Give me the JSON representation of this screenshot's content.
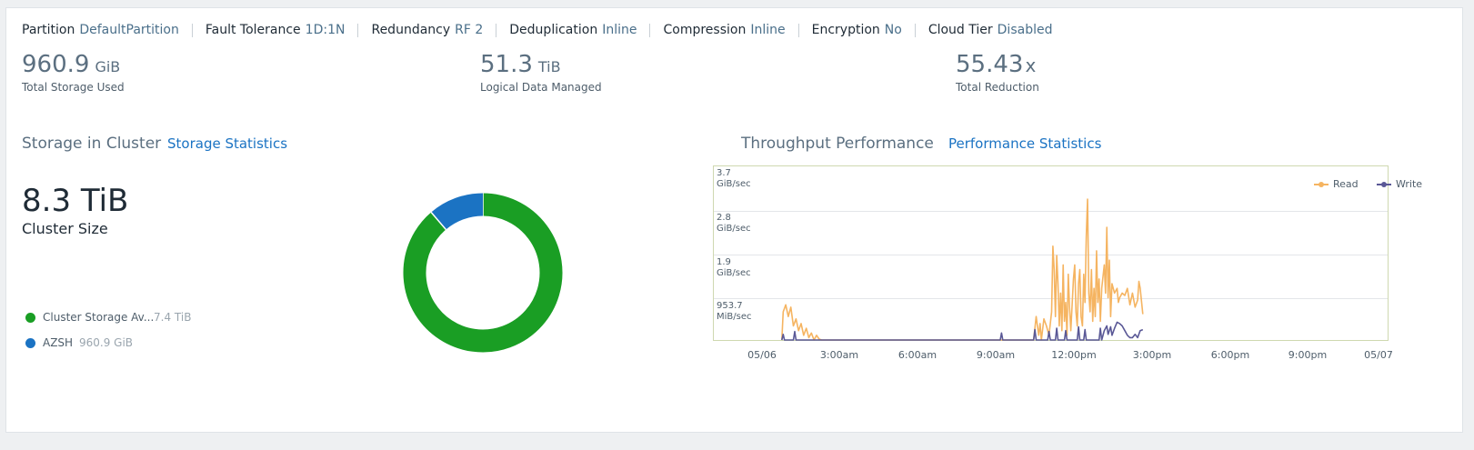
{
  "properties": [
    {
      "key": "Partition",
      "value": "DefaultPartition"
    },
    {
      "key": "Fault Tolerance",
      "value": "1D:1N"
    },
    {
      "key": "Redundancy",
      "value": "RF 2"
    },
    {
      "key": "Deduplication",
      "value": "Inline"
    },
    {
      "key": "Compression",
      "value": "Inline"
    },
    {
      "key": "Encryption",
      "value": "No"
    },
    {
      "key": "Cloud Tier",
      "value": "Disabled"
    }
  ],
  "metrics": {
    "storage_used": {
      "value": "960.9",
      "unit": "GiB",
      "label": "Total Storage Used"
    },
    "logical_data": {
      "value": "51.3",
      "unit": "TiB",
      "label": "Logical Data Managed"
    },
    "reduction": {
      "value": "55.43",
      "unit": "x",
      "label": "Total Reduction"
    }
  },
  "storage_section": {
    "title": "Storage in Cluster",
    "link": "Storage Statistics",
    "cluster_size": "8.3 TiB",
    "cluster_size_label": "Cluster Size",
    "legend": [
      {
        "name": "Cluster Storage Av...",
        "value": "7.4 TiB",
        "color": "#1a9e24"
      },
      {
        "name": "AZSH",
        "value": "960.9 GiB",
        "color": "#1b73c3"
      }
    ]
  },
  "donut": {
    "slices": [
      {
        "label": "Cluster Storage Available",
        "amount_gib": 7577.6,
        "color": "#1a9e24"
      },
      {
        "label": "AZSH",
        "amount_gib": 960.9,
        "color": "#1b73c3"
      }
    ]
  },
  "perf_section": {
    "title": "Throughput Performance",
    "link": "Performance Statistics"
  },
  "chart_data": {
    "type": "line",
    "y_ticks": [
      {
        "value": "3.7",
        "unit": "GiB/sec"
      },
      {
        "value": "2.8",
        "unit": "GiB/sec"
      },
      {
        "value": "1.9",
        "unit": "GiB/sec"
      },
      {
        "value": "953.7",
        "unit": "MiB/sec"
      }
    ],
    "x_ticks": [
      "05/06",
      "3:00am",
      "6:00am",
      "9:00am",
      "12:00pm",
      "3:00pm",
      "6:00pm",
      "9:00pm",
      "05/07"
    ],
    "ylim": [
      0,
      3.7
    ],
    "grid": true,
    "legend_position": "top-right",
    "series": [
      {
        "name": "Read",
        "color": "#f5b461",
        "points": [
          [
            0.95,
            0
          ],
          [
            1.0,
            0.6
          ],
          [
            1.1,
            0.75
          ],
          [
            1.2,
            0.5
          ],
          [
            1.3,
            0.7
          ],
          [
            1.4,
            0.3
          ],
          [
            1.5,
            0.45
          ],
          [
            1.6,
            0.2
          ],
          [
            1.7,
            0.35
          ],
          [
            1.8,
            0.1
          ],
          [
            1.9,
            0.25
          ],
          [
            2.0,
            0.05
          ],
          [
            2.1,
            0.15
          ],
          [
            2.2,
            0
          ],
          [
            2.3,
            0.1
          ],
          [
            2.4,
            0.02
          ],
          [
            2.5,
            0
          ],
          [
            10.75,
            0
          ],
          [
            10.85,
            0.5
          ],
          [
            10.95,
            0.1
          ],
          [
            11.0,
            0.35
          ],
          [
            11.05,
            0
          ],
          [
            11.15,
            0.45
          ],
          [
            11.25,
            0.3
          ],
          [
            11.35,
            0.1
          ],
          [
            11.45,
            0.6
          ],
          [
            11.5,
            2.0
          ],
          [
            11.55,
            1.5
          ],
          [
            11.6,
            0.5
          ],
          [
            11.65,
            1.8
          ],
          [
            11.7,
            1.2
          ],
          [
            11.75,
            0.3
          ],
          [
            11.8,
            1.0
          ],
          [
            11.85,
            0.2
          ],
          [
            11.9,
            1.6
          ],
          [
            11.95,
            0.4
          ],
          [
            12.0,
            0.8
          ],
          [
            12.05,
            0.1
          ],
          [
            12.1,
            1.4
          ],
          [
            12.15,
            0.7
          ],
          [
            12.2,
            0.2
          ],
          [
            12.3,
            1.3
          ],
          [
            12.35,
            1.6
          ],
          [
            12.4,
            0.6
          ],
          [
            12.45,
            0.3
          ],
          [
            12.5,
            1.2
          ],
          [
            12.55,
            1.5
          ],
          [
            12.6,
            0.5
          ],
          [
            12.65,
            0.3
          ],
          [
            12.7,
            1.4
          ],
          [
            12.75,
            0.8
          ],
          [
            12.8,
            2.2
          ],
          [
            12.85,
            3.0
          ],
          [
            12.9,
            1.0
          ],
          [
            12.95,
            0.6
          ],
          [
            13.0,
            1.5
          ],
          [
            13.05,
            0.4
          ],
          [
            13.1,
            1.1
          ],
          [
            13.15,
            0.5
          ],
          [
            13.2,
            1.9
          ],
          [
            13.25,
            0.8
          ],
          [
            13.3,
            1.3
          ],
          [
            13.35,
            0.4
          ],
          [
            13.4,
            1.1
          ],
          [
            13.5,
            1.6
          ],
          [
            13.55,
            1.0
          ],
          [
            13.6,
            2.4
          ],
          [
            13.65,
            0.9
          ],
          [
            13.7,
            1.7
          ],
          [
            13.75,
            0.5
          ],
          [
            13.8,
            1.2
          ],
          [
            13.9,
            1.0
          ],
          [
            14.0,
            1.1
          ],
          [
            14.05,
            0.8
          ],
          [
            14.1,
            0.9
          ],
          [
            14.2,
            1.0
          ],
          [
            14.3,
            0.95
          ],
          [
            14.4,
            1.1
          ],
          [
            14.5,
            0.75
          ],
          [
            14.6,
            1.0
          ],
          [
            14.7,
            0.7
          ],
          [
            14.8,
            0.85
          ],
          [
            14.85,
            1.25
          ],
          [
            14.9,
            1.1
          ],
          [
            15.0,
            0.55
          ]
        ]
      },
      {
        "name": "Write",
        "color": "#5a5896",
        "points": [
          [
            0.95,
            0
          ],
          [
            1.0,
            0.12
          ],
          [
            1.05,
            0
          ],
          [
            1.4,
            0
          ],
          [
            1.45,
            0.18
          ],
          [
            1.5,
            0
          ],
          [
            2.5,
            0
          ],
          [
            3.0,
            0
          ],
          [
            9.0,
            0
          ],
          [
            9.45,
            0
          ],
          [
            9.5,
            0.15
          ],
          [
            9.55,
            0
          ],
          [
            10.75,
            0
          ],
          [
            10.8,
            0.22
          ],
          [
            10.85,
            0
          ],
          [
            11.3,
            0
          ],
          [
            11.35,
            0.18
          ],
          [
            11.4,
            0
          ],
          [
            11.6,
            0
          ],
          [
            11.65,
            0.25
          ],
          [
            11.7,
            0
          ],
          [
            11.95,
            0
          ],
          [
            12.0,
            0.2
          ],
          [
            12.05,
            0
          ],
          [
            12.45,
            0
          ],
          [
            12.5,
            0.28
          ],
          [
            12.55,
            0
          ],
          [
            12.7,
            0
          ],
          [
            12.75,
            0.22
          ],
          [
            12.8,
            0
          ],
          [
            13.3,
            0
          ],
          [
            13.35,
            0.25
          ],
          [
            13.4,
            0
          ],
          [
            13.5,
            0.2
          ],
          [
            13.6,
            0.3
          ],
          [
            13.65,
            0.12
          ],
          [
            13.75,
            0.28
          ],
          [
            13.8,
            0.1
          ],
          [
            13.9,
            0.25
          ],
          [
            14.0,
            0.38
          ],
          [
            14.1,
            0.35
          ],
          [
            14.2,
            0.3
          ],
          [
            14.3,
            0.2
          ],
          [
            14.4,
            0.1
          ],
          [
            14.5,
            0.05
          ],
          [
            14.6,
            0.05
          ],
          [
            14.7,
            0.12
          ],
          [
            14.8,
            0.05
          ],
          [
            14.9,
            0.2
          ],
          [
            15.0,
            0.22
          ]
        ]
      }
    ]
  }
}
